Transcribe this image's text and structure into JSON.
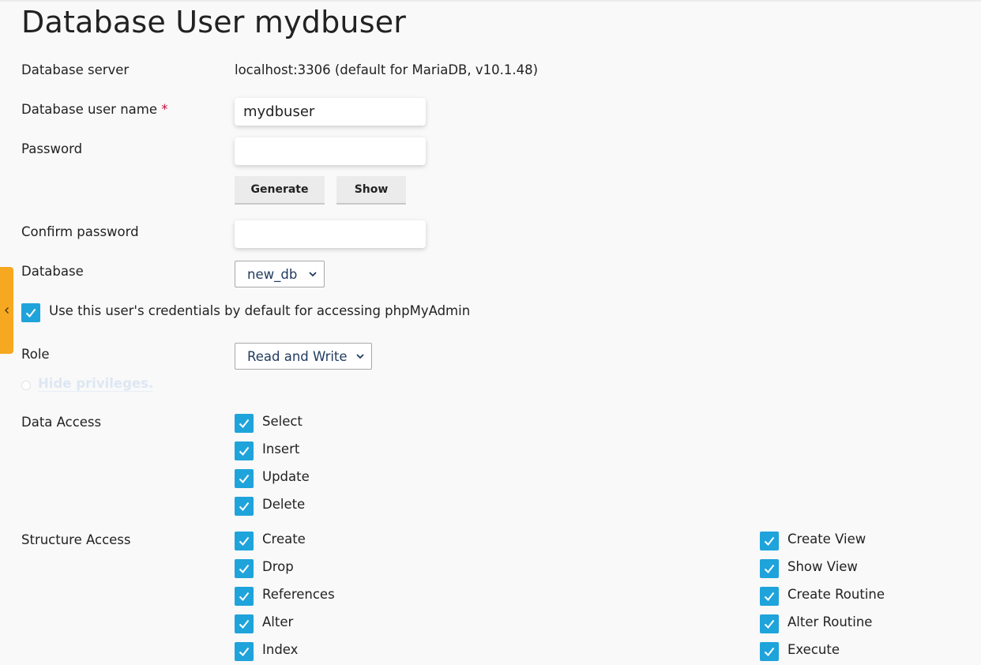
{
  "page": {
    "title": "Database User mydbuser"
  },
  "form": {
    "server": {
      "label": "Database server",
      "value": "localhost:3306 (default for MariaDB, v10.1.48)"
    },
    "username": {
      "label": "Database user name",
      "required_mark": "*",
      "value": "mydbuser"
    },
    "password": {
      "label": "Password",
      "value": "",
      "generate_label": "Generate",
      "show_label": "Show"
    },
    "confirm": {
      "label": "Confirm password",
      "value": ""
    },
    "database": {
      "label": "Database",
      "selected": "new_db"
    },
    "default_credentials": {
      "label": "Use this user's credentials by default for accessing phpMyAdmin",
      "checked": true
    },
    "role": {
      "label": "Role",
      "selected": "Read and Write"
    },
    "privileges_toggle": {
      "label": "Hide privileges."
    }
  },
  "privileges": {
    "data_access": {
      "label": "Data Access",
      "items": [
        "Select",
        "Insert",
        "Update",
        "Delete"
      ]
    },
    "structure_access": {
      "label": "Structure Access",
      "left_items": [
        "Create",
        "Drop",
        "References",
        "Alter",
        "Index"
      ],
      "right_items": [
        "Create View",
        "Show View",
        "Create Routine",
        "Alter Routine",
        "Execute"
      ]
    }
  },
  "colors": {
    "accent": "#1fa3db",
    "side_tab": "#f6a821",
    "required": "#c0113d"
  },
  "icons": {
    "check": "check-icon",
    "dropdown": "chevron-down-icon",
    "side_tab": "chevron-left-icon"
  }
}
